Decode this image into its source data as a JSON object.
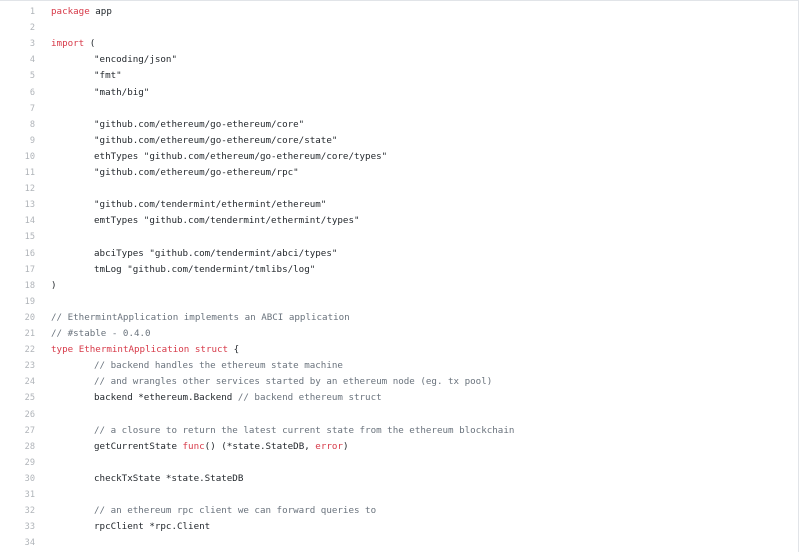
{
  "file": {
    "lines": [
      {
        "n": "1",
        "indent": "",
        "parts": [
          {
            "t": "package",
            "c": "kw"
          },
          {
            "t": " app",
            "c": ""
          }
        ]
      },
      {
        "n": "2",
        "indent": "",
        "parts": []
      },
      {
        "n": "3",
        "indent": "",
        "parts": [
          {
            "t": "import",
            "c": "kw"
          },
          {
            "t": " (",
            "c": ""
          }
        ]
      },
      {
        "n": "4",
        "indent": "\t",
        "parts": [
          {
            "t": "\"encoding/json\"",
            "c": ""
          }
        ]
      },
      {
        "n": "5",
        "indent": "\t",
        "parts": [
          {
            "t": "\"fmt\"",
            "c": ""
          }
        ]
      },
      {
        "n": "6",
        "indent": "\t",
        "parts": [
          {
            "t": "\"math/big\"",
            "c": ""
          }
        ]
      },
      {
        "n": "7",
        "indent": "",
        "parts": []
      },
      {
        "n": "8",
        "indent": "\t",
        "parts": [
          {
            "t": "\"github.com/ethereum/go-ethereum/core\"",
            "c": ""
          }
        ]
      },
      {
        "n": "9",
        "indent": "\t",
        "parts": [
          {
            "t": "\"github.com/ethereum/go-ethereum/core/state\"",
            "c": ""
          }
        ]
      },
      {
        "n": "10",
        "indent": "\t",
        "parts": [
          {
            "t": "ethTypes \"github.com/ethereum/go-ethereum/core/types\"",
            "c": ""
          }
        ]
      },
      {
        "n": "11",
        "indent": "\t",
        "parts": [
          {
            "t": "\"github.com/ethereum/go-ethereum/rpc\"",
            "c": ""
          }
        ]
      },
      {
        "n": "12",
        "indent": "",
        "parts": []
      },
      {
        "n": "13",
        "indent": "\t",
        "parts": [
          {
            "t": "\"github.com/tendermint/ethermint/ethereum\"",
            "c": ""
          }
        ]
      },
      {
        "n": "14",
        "indent": "\t",
        "parts": [
          {
            "t": "emtTypes \"github.com/tendermint/ethermint/types\"",
            "c": ""
          }
        ]
      },
      {
        "n": "15",
        "indent": "",
        "parts": []
      },
      {
        "n": "16",
        "indent": "\t",
        "parts": [
          {
            "t": "abciTypes \"github.com/tendermint/abci/types\"",
            "c": ""
          }
        ]
      },
      {
        "n": "17",
        "indent": "\t",
        "parts": [
          {
            "t": "tmLog \"github.com/tendermint/tmlibs/log\"",
            "c": ""
          }
        ]
      },
      {
        "n": "18",
        "indent": "",
        "parts": [
          {
            "t": ")",
            "c": ""
          }
        ]
      },
      {
        "n": "19",
        "indent": "",
        "parts": []
      },
      {
        "n": "20",
        "indent": "",
        "parts": [
          {
            "t": "// EthermintApplication implements an ABCI application",
            "c": "cm"
          }
        ]
      },
      {
        "n": "21",
        "indent": "",
        "parts": [
          {
            "t": "// #stable - 0.4.0",
            "c": "cm"
          }
        ]
      },
      {
        "n": "22",
        "indent": "",
        "parts": [
          {
            "t": "type",
            "c": "kw"
          },
          {
            "t": " ",
            "c": ""
          },
          {
            "t": "EthermintApplication",
            "c": "tp"
          },
          {
            "t": " ",
            "c": ""
          },
          {
            "t": "struct",
            "c": "kw"
          },
          {
            "t": " {",
            "c": ""
          }
        ]
      },
      {
        "n": "23",
        "indent": "\t",
        "parts": [
          {
            "t": "// backend handles the ethereum state machine",
            "c": "cm"
          }
        ]
      },
      {
        "n": "24",
        "indent": "\t",
        "parts": [
          {
            "t": "// and wrangles other services started by an ethereum node (eg. tx pool)",
            "c": "cm"
          }
        ]
      },
      {
        "n": "25",
        "indent": "\t",
        "parts": [
          {
            "t": "backend *ethereum.Backend ",
            "c": ""
          },
          {
            "t": "// backend ethereum struct",
            "c": "cm"
          }
        ]
      },
      {
        "n": "26",
        "indent": "",
        "parts": []
      },
      {
        "n": "27",
        "indent": "\t",
        "parts": [
          {
            "t": "// a closure to return the latest current state from the ethereum blockchain",
            "c": "cm"
          }
        ]
      },
      {
        "n": "28",
        "indent": "\t",
        "parts": [
          {
            "t": "getCurrentState ",
            "c": ""
          },
          {
            "t": "func",
            "c": "kw"
          },
          {
            "t": "() (*state.StateDB, ",
            "c": ""
          },
          {
            "t": "error",
            "c": "kw"
          },
          {
            "t": ")",
            "c": ""
          }
        ]
      },
      {
        "n": "29",
        "indent": "",
        "parts": []
      },
      {
        "n": "30",
        "indent": "\t",
        "parts": [
          {
            "t": "checkTxState *state.StateDB",
            "c": ""
          }
        ]
      },
      {
        "n": "31",
        "indent": "",
        "parts": []
      },
      {
        "n": "32",
        "indent": "\t",
        "parts": [
          {
            "t": "// an ethereum rpc client we can forward queries to",
            "c": "cm"
          }
        ]
      },
      {
        "n": "33",
        "indent": "\t",
        "parts": [
          {
            "t": "rpcClient *rpc.Client",
            "c": ""
          }
        ]
      },
      {
        "n": "34",
        "indent": "",
        "parts": []
      }
    ]
  },
  "colors": {
    "keyword": "#d73a49",
    "comment": "#6a737d",
    "text": "#24292e",
    "gutter": "#b0b4b9"
  }
}
